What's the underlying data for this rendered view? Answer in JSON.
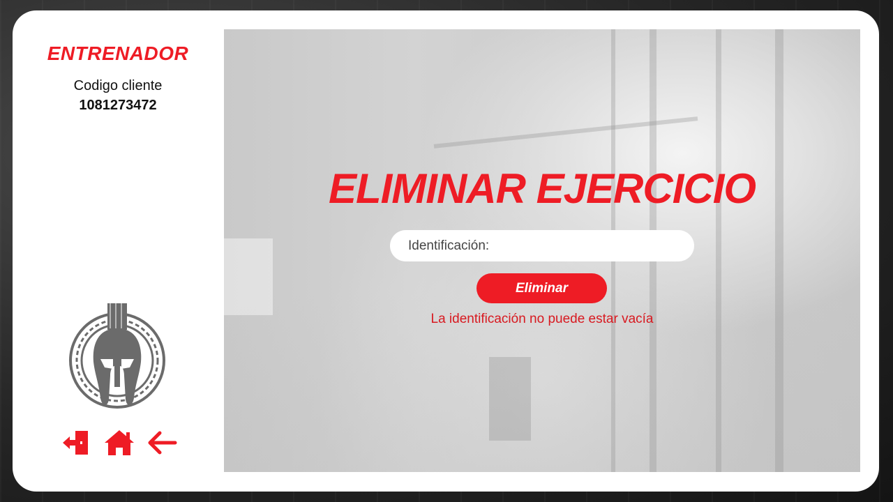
{
  "sidebar": {
    "role": "ENTRENADOR",
    "client_label": "Codigo cliente",
    "client_code": "1081273472",
    "logo_icon": "spartan-helmet-logo",
    "nav": [
      {
        "icon": "logout-icon",
        "label": "Salir"
      },
      {
        "icon": "home-icon",
        "label": "Inicio"
      },
      {
        "icon": "arrow-left-icon",
        "label": "Volver"
      }
    ]
  },
  "main": {
    "title": "ELIMINAR EJERCICIO",
    "id_field": {
      "placeholder": "Identificación:",
      "value": ""
    },
    "delete_button": "Eliminar",
    "error": "La identificación no puede estar vacía"
  },
  "colors": {
    "accent": "#ee1c25",
    "card": "#ffffff",
    "logo": "#6b6b6b"
  }
}
